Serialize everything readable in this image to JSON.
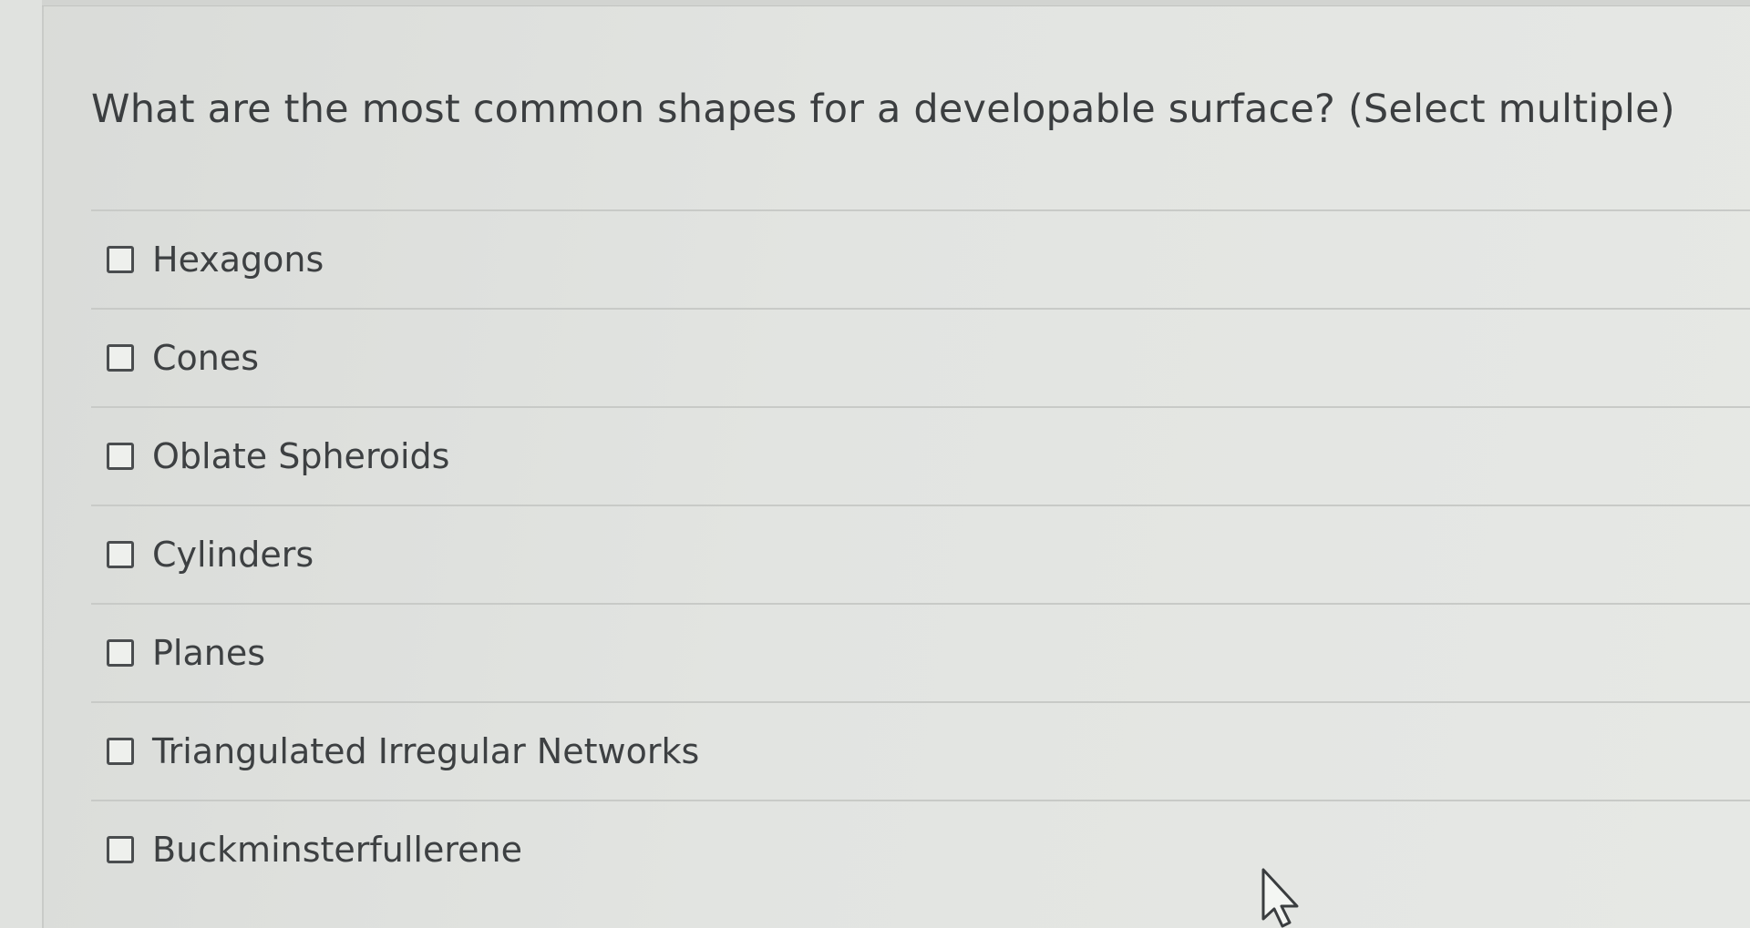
{
  "question": {
    "text": "What are the most common shapes for a developable surface? (Select multiple)"
  },
  "options": [
    {
      "label": "Hexagons",
      "checked": false
    },
    {
      "label": "Cones",
      "checked": false
    },
    {
      "label": "Oblate Spheroids",
      "checked": false
    },
    {
      "label": "Cylinders",
      "checked": false
    },
    {
      "label": "Planes",
      "checked": false
    },
    {
      "label": "Triangulated Irregular Networks",
      "checked": false
    },
    {
      "label": "Buckminsterfullerene",
      "checked": false
    }
  ],
  "icons": {
    "cursor": "mouse-pointer-icon"
  }
}
